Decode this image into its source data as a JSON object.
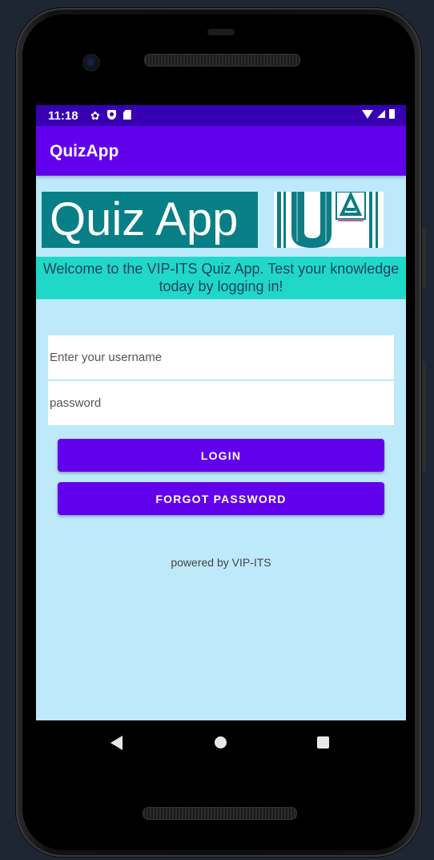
{
  "status_bar": {
    "time": "11:18",
    "left_icons": [
      "gear-icon",
      "shield-icon",
      "sd-card-icon"
    ],
    "right_icons": [
      "wifi-icon",
      "signal-icon",
      "battery-icon"
    ]
  },
  "app_bar": {
    "title": "QuizApp",
    "color": "#6200ee",
    "status_color": "#3700b3"
  },
  "banner": {
    "text": "Quiz App",
    "background": "#087f86",
    "logo_letters": "UA",
    "logo_icon": "ua-logo-icon"
  },
  "welcome": {
    "text": "Welcome to the VIP-ITS Quiz App. Test your knowledge today by logging in!",
    "background": "#20d8c8"
  },
  "form": {
    "username_placeholder": "Enter your username",
    "username_value": "",
    "password_placeholder": "password",
    "password_value": ""
  },
  "buttons": {
    "login_label": "LOGIN",
    "forgot_label": "FORGOT PASSWORD"
  },
  "footer": {
    "powered_by": "powered by VIP-ITS"
  },
  "nav_bar": {
    "icons": [
      "back-icon",
      "home-icon",
      "recents-icon"
    ]
  },
  "colors": {
    "screen_background": "#bde9fb",
    "accent": "#6200ee"
  }
}
